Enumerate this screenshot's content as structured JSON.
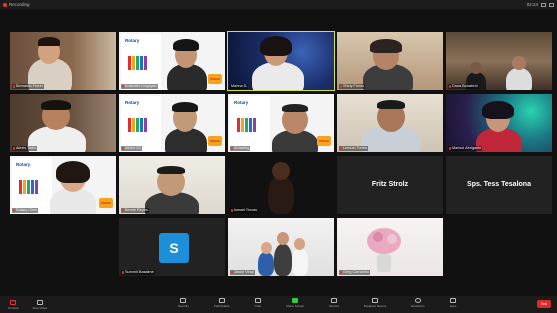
{
  "titlebar": {
    "recording": "Recording",
    "time": "02:24"
  },
  "participants": [
    {
      "name": "Bernardo Ferrer",
      "row": 0,
      "col": 0
    },
    {
      "name": "Kristoffer Lingayan",
      "row": 0,
      "col": 1
    },
    {
      "name": "Marina D.",
      "row": 0,
      "col": 2
    },
    {
      "name": "Shirly Flores",
      "row": 0,
      "col": 3
    },
    {
      "name": "Dana Banatichi",
      "row": 0,
      "col": 4
    },
    {
      "name": "Alexis Tadlo",
      "row": 1,
      "col": 0
    },
    {
      "name": "Albert Gil",
      "row": 1,
      "col": 1
    },
    {
      "name": "Al Barleg",
      "row": 1,
      "col": 2
    },
    {
      "name": "Lemuel Torres",
      "row": 1,
      "col": 3
    },
    {
      "name": "Marisol Abrigante",
      "row": 1,
      "col": 4
    },
    {
      "name": "Rotary Chris",
      "row": 2,
      "col": 0
    },
    {
      "name": "Bernie Reyes",
      "row": 2,
      "col": 1
    },
    {
      "name": "Ismael Roxas",
      "row": 2,
      "col": 2
    },
    {
      "name": "Fritz Strolz",
      "row": 2,
      "col": 3
    },
    {
      "name": "Sps. Tess Tesalona",
      "row": 2,
      "col": 4
    },
    {
      "name": "Summit Basalme",
      "row": 3,
      "col": 1
    },
    {
      "name": "Jason Viray",
      "row": 3,
      "col": 2
    },
    {
      "name": "Greg Camaribo",
      "row": 3,
      "col": 3
    }
  ],
  "rotary": {
    "brand": "Rotary",
    "label": "Rotary"
  },
  "avatar_letter": "S",
  "toolbar": {
    "unmute": "Unmute",
    "stop_video": "Stop Video",
    "security": "Security",
    "participants": "Participants",
    "chat": "Chat",
    "share_screen": "Share Screen",
    "record": "Record",
    "breakout": "Breakout Rooms",
    "reactions": "Reactions",
    "apps": "Apps",
    "end": "End"
  },
  "colors": {
    "accent": "#d4e23a",
    "end": "#e02828",
    "share": "#2ecc40"
  }
}
